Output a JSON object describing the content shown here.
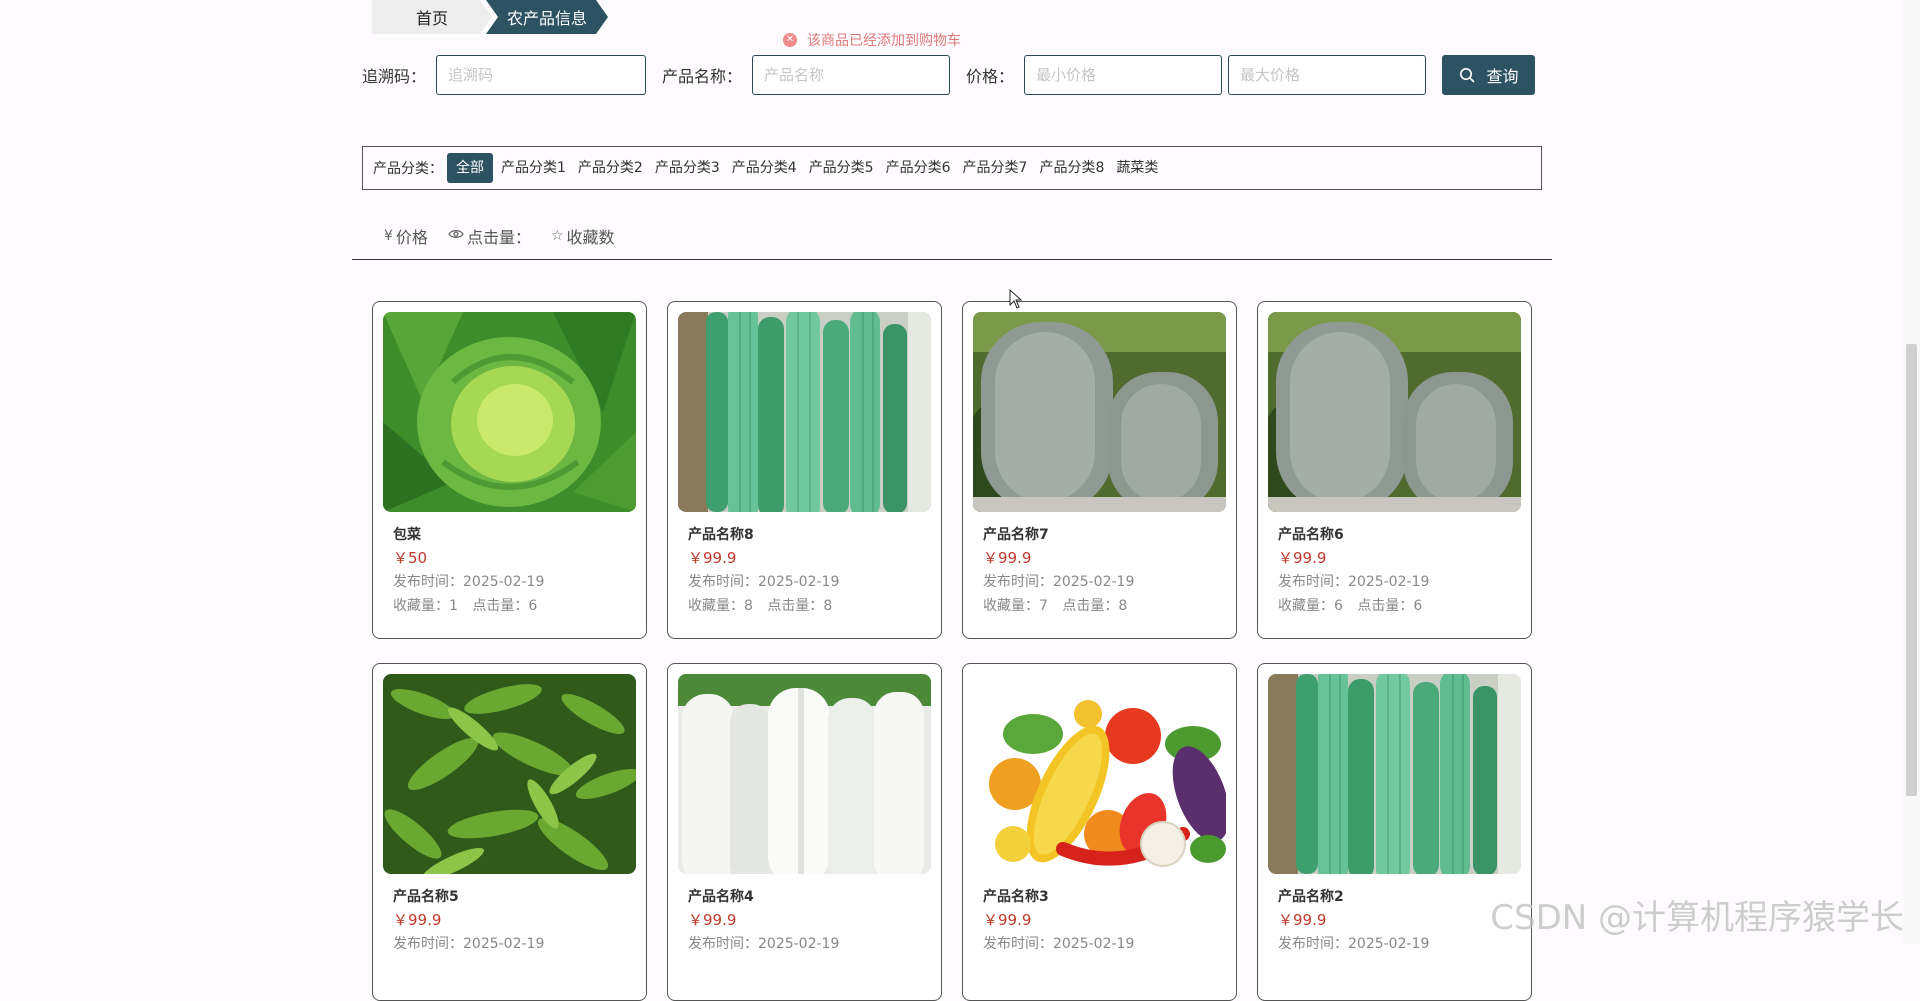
{
  "breadcrumb": {
    "home": "首页",
    "current": "农产品信息"
  },
  "toast": {
    "message": "该商品已经添加到购物车",
    "icon": "error-circle-icon",
    "color": "#e07a7a"
  },
  "search": {
    "trace_label": "追溯码：",
    "trace_placeholder": "追溯码",
    "name_label": "产品名称：",
    "name_placeholder": "产品名称",
    "price_label": "价格：",
    "min_price_placeholder": "最小价格",
    "max_price_placeholder": "最大价格",
    "button_label": "查询",
    "button_icon": "search-icon"
  },
  "categories": {
    "label": "产品分类：",
    "items": [
      "全部",
      "产品分类1",
      "产品分类2",
      "产品分类3",
      "产品分类4",
      "产品分类5",
      "产品分类6",
      "产品分类7",
      "产品分类8",
      "蔬菜类"
    ],
    "active": "全部"
  },
  "sort": {
    "price": "价格",
    "price_icon": "yen-icon",
    "clicks": "点击量：",
    "clicks_icon": "eye-icon",
    "favorites": "收藏数",
    "favorites_icon": "star-icon"
  },
  "labels": {
    "publish_prefix": "发布时间：",
    "fav_prefix": "收藏量：",
    "click_prefix": "点击量："
  },
  "products": [
    {
      "name": "包菜",
      "price": "￥50",
      "date": "2025-02-19",
      "favorites": "1",
      "clicks": "6",
      "image": "cabbage"
    },
    {
      "name": "产品名称8",
      "price": "￥99.9",
      "date": "2025-02-19",
      "favorites": "8",
      "clicks": "8",
      "image": "luffa"
    },
    {
      "name": "产品名称7",
      "price": "￥99.9",
      "date": "2025-02-19",
      "favorites": "7",
      "clicks": "8",
      "image": "winter-melon"
    },
    {
      "name": "产品名称6",
      "price": "￥99.9",
      "date": "2025-02-19",
      "favorites": "6",
      "clicks": "6",
      "image": "winter-melon"
    },
    {
      "name": "产品名称5",
      "price": "￥99.9",
      "date": "2025-02-19",
      "favorites": "",
      "clicks": "",
      "image": "peppers"
    },
    {
      "name": "产品名称4",
      "price": "￥99.9",
      "date": "2025-02-19",
      "favorites": "",
      "clicks": "",
      "image": "radish"
    },
    {
      "name": "产品名称3",
      "price": "￥99.9",
      "date": "2025-02-19",
      "favorites": "",
      "clicks": "",
      "image": "vegetables-mix"
    },
    {
      "name": "产品名称2",
      "price": "￥99.9",
      "date": "2025-02-19",
      "favorites": "",
      "clicks": "",
      "image": "luffa"
    }
  ],
  "watermark": "CSDN @计算机程序猿学长",
  "colors": {
    "primary": "#2d5362",
    "price": "#c0392b",
    "meta": "#888888"
  }
}
